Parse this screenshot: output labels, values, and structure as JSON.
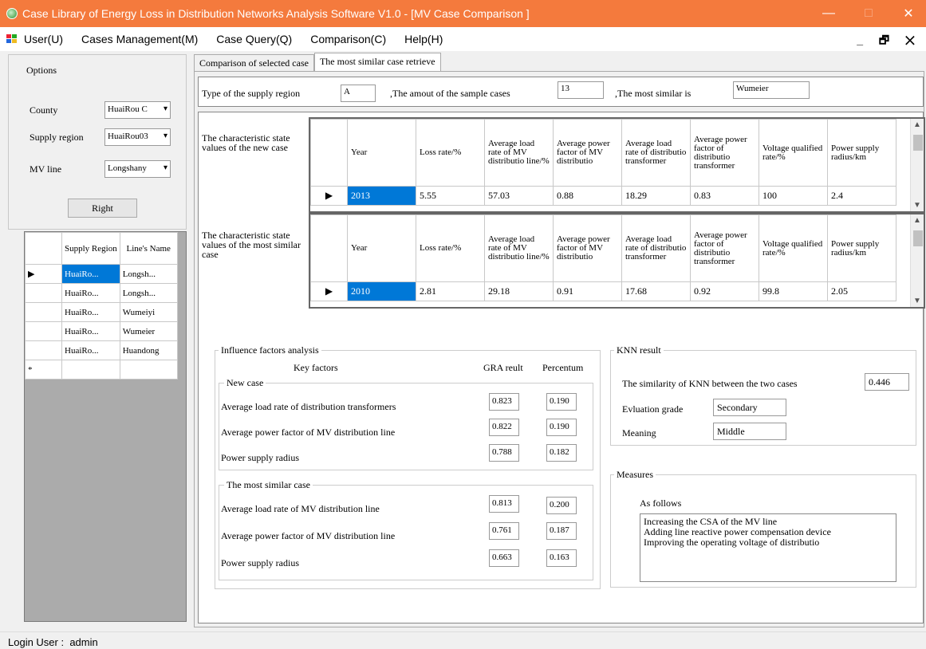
{
  "window": {
    "title": "Case Library of Energy Loss in Distribution Networks Analysis Software V1.0 - [MV Case Comparison ]",
    "minimize": "—",
    "maximize": "□",
    "close": "✕"
  },
  "menu": {
    "items": [
      "User(U)",
      "Cases Management(M)",
      "Case Query(Q)",
      "Comparison(C)",
      "Help(H)"
    ],
    "mdi_controls": "_ 🗗 ✕"
  },
  "options": {
    "title": "Options",
    "county_label": "County",
    "county_value": "HuaiRou C",
    "supply_region_label": "Supply region",
    "supply_region_value": "HuaiRou03",
    "mv_line_label": "MV line",
    "mv_line_value": "Longshany",
    "right_button": "Right"
  },
  "line_grid": {
    "headers": [
      "Supply Region",
      "Line's Name"
    ],
    "rows": [
      [
        "HuaiRo...",
        "Longsh..."
      ],
      [
        "HuaiRo...",
        "Longsh..."
      ],
      [
        "HuaiRo...",
        "Wumeiyi"
      ],
      [
        "HuaiRo...",
        "Wumeier"
      ],
      [
        "HuaiRo...",
        "Huandong"
      ]
    ],
    "row_marker": "▶",
    "new_row_marker": "*"
  },
  "tabs": [
    "Comparison of selected case",
    "The most similar case retrieve"
  ],
  "top_strip": {
    "region_type_label": "Type of the supply region",
    "region_type_value": "A",
    "sample_count_label": ",The amout of the sample cases",
    "sample_count_value": "13",
    "most_similar_label": ",The most similar is",
    "most_similar_value": "Wumeier"
  },
  "new_case": {
    "label": "The characteristic state values of the new case",
    "headers": [
      "Year",
      "Loss rate/%",
      "Average load rate of MV distributio line/%",
      "Average power factor of MV distributio",
      "Average load rate of distributio transformer",
      "Average power factor of distributio transformer",
      "Voltage qualified rate/%",
      "Power supply radius/km"
    ],
    "row": [
      "2013",
      "5.55",
      "57.03",
      "0.88",
      "18.29",
      "0.83",
      "100",
      "2.4"
    ]
  },
  "similar_case": {
    "label": "The characteristic state values of the most similar case",
    "headers": [
      "Year",
      "Loss rate/%",
      "Average load rate of MV distributio line/%",
      "Average power factor of MV distributio",
      "Average load rate of distributio transformer",
      "Average power factor of distributio transformer",
      "Voltage qualified rate/%",
      "Power supply radius/km"
    ],
    "row": [
      "2010",
      "2.81",
      "29.18",
      "0.91",
      "17.68",
      "0.92",
      "99.8",
      "2.05"
    ]
  },
  "influence": {
    "title": "Influence factors analysis",
    "key_factors_header": "Key factors",
    "gra_header": "GRA reult",
    "percent_header": "Percentum",
    "new_case_title": "New case",
    "new_case_rows": [
      {
        "factor": "Average load rate of distribution transformers",
        "gra": "0.823",
        "pct": "0.190"
      },
      {
        "factor": "Average power factor of MV distribution line",
        "gra": "0.822",
        "pct": "0.190"
      },
      {
        "factor": "Power supply radius",
        "gra": "0.788",
        "pct": "0.182"
      }
    ],
    "similar_title": "The most similar case",
    "similar_rows": [
      {
        "factor": "Average load rate of MV distribution line",
        "gra": "0.813",
        "pct": "0.200"
      },
      {
        "factor": "Average power factor of MV distribution line",
        "gra": "0.761",
        "pct": "0.187"
      },
      {
        "factor": "Power supply radius",
        "gra": "0.663",
        "pct": "0.163"
      }
    ]
  },
  "knn": {
    "title": "KNN result",
    "similarity_label": "The similarity of KNN between the two cases",
    "similarity_value": "0.446",
    "grade_label": "Evluation grade",
    "grade_value": "Secondary",
    "meaning_label": "Meaning",
    "meaning_value": "Middle"
  },
  "measures": {
    "title": "Measures",
    "as_follows": "As follows",
    "lines": [
      "Increasing the CSA of the MV line",
      "Adding line reactive power compensation device",
      "Improving the operating voltage of distributio"
    ]
  },
  "status": {
    "login_label": "Login User :",
    "login_user": "admin"
  }
}
